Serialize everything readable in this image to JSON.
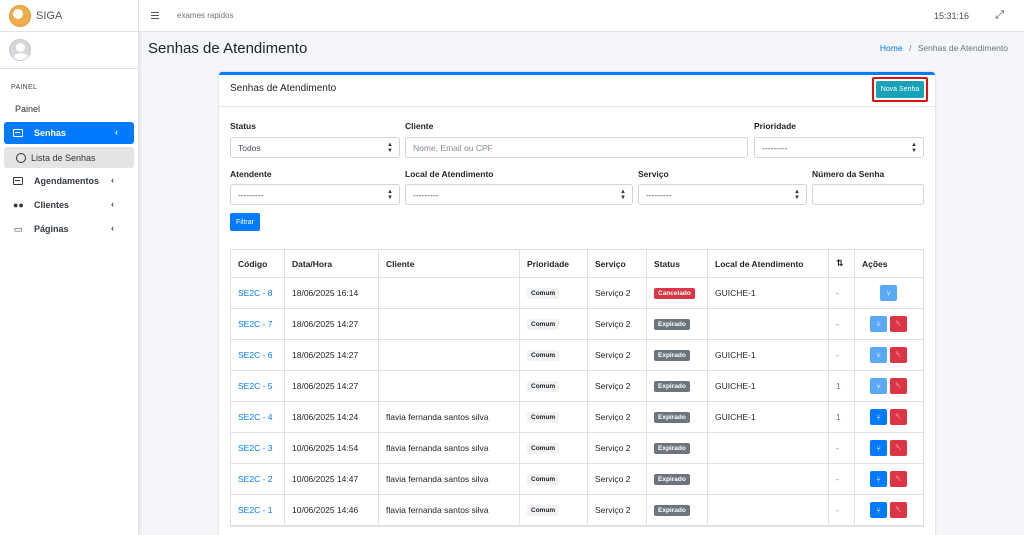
{
  "app": {
    "name": "SIGA"
  },
  "sidebar": {
    "header": "PAINEL",
    "painel": "Painel",
    "active": {
      "label": "Senhas"
    },
    "sub": {
      "label": "Lista de Senhas"
    },
    "items": [
      {
        "label": "Agendamentos",
        "icon": "calendar-icon"
      },
      {
        "label": "Clientes",
        "icon": "users-icon"
      },
      {
        "label": "Páginas",
        "icon": "monitor-icon"
      }
    ]
  },
  "topbar": {
    "link": "exames rapidos",
    "time": "15:31:16"
  },
  "page": {
    "title": "Senhas de Atendimento"
  },
  "breadcrumb": {
    "home": "Home",
    "separator": "/",
    "current": "Senhas de Atendimento"
  },
  "card": {
    "title": "Senhas de Atendimento",
    "new_button": "Nova Senha"
  },
  "filters": {
    "status": {
      "label": "Status",
      "value": "Todos"
    },
    "cliente": {
      "label": "Cliente",
      "placeholder": "Nome, Email ou CPF"
    },
    "prioridade": {
      "label": "Prioridade",
      "value": "---------"
    },
    "atendente": {
      "label": "Atendente",
      "value": "---------"
    },
    "local": {
      "label": "Local de Atendimento",
      "value": "---------"
    },
    "servico": {
      "label": "Serviço",
      "value": "---------"
    },
    "numero": {
      "label": "Número da Senha",
      "value": ""
    },
    "submit": "Filtrar"
  },
  "table": {
    "headers": {
      "codigo": "Código",
      "datahora": "Data/Hora",
      "cliente": "Cliente",
      "prioridade": "Prioridade",
      "servico": "Serviço",
      "status": "Status",
      "local": "Local de Atendimento",
      "acoes": "Ações"
    },
    "colors": {
      "cancelado": "#dc3545",
      "expirado": "#6c757d"
    },
    "rows": [
      {
        "codigo": "SE2C - 8",
        "datahora": "18/06/2025 16:14",
        "cliente": "",
        "prioridade": "Comum",
        "servico": "Serviço 2",
        "status": "Cancelado",
        "local": "GUICHE-1",
        "count": "-"
      },
      {
        "codigo": "SE2C - 7",
        "datahora": "18/06/2025 14:27",
        "cliente": "",
        "prioridade": "Comum",
        "servico": "Serviço 2",
        "status": "Expirado",
        "local": "",
        "count": "-"
      },
      {
        "codigo": "SE2C - 6",
        "datahora": "18/06/2025 14:27",
        "cliente": "",
        "prioridade": "Comum",
        "servico": "Serviço 2",
        "status": "Expirado",
        "local": "GUICHE-1",
        "count": "-"
      },
      {
        "codigo": "SE2C - 5",
        "datahora": "18/06/2025 14:27",
        "cliente": "",
        "prioridade": "Comum",
        "servico": "Serviço 2",
        "status": "Expirado",
        "local": "GUICHE-1",
        "count": "1"
      },
      {
        "codigo": "SE2C - 4",
        "datahora": "18/06/2025 14:24",
        "cliente": "flavia fernanda santos silva",
        "prioridade": "Comum",
        "servico": "Serviço 2",
        "status": "Expirado",
        "local": "GUICHE-1",
        "count": "1"
      },
      {
        "codigo": "SE2C - 3",
        "datahora": "10/06/2025 14:54",
        "cliente": "flavia fernanda santos silva",
        "prioridade": "Comum",
        "servico": "Serviço 2",
        "status": "Expirado",
        "local": "",
        "count": "-"
      },
      {
        "codigo": "SE2C - 2",
        "datahora": "10/06/2025 14:47",
        "cliente": "flavia fernanda santos silva",
        "prioridade": "Comum",
        "servico": "Serviço 2",
        "status": "Expirado",
        "local": "",
        "count": "-"
      },
      {
        "codigo": "SE2C - 1",
        "datahora": "10/06/2025 14:46",
        "cliente": "flavia fernanda santos silva",
        "prioridade": "Comum",
        "servico": "Serviço 2",
        "status": "Expirado",
        "local": "",
        "count": "-"
      }
    ]
  }
}
